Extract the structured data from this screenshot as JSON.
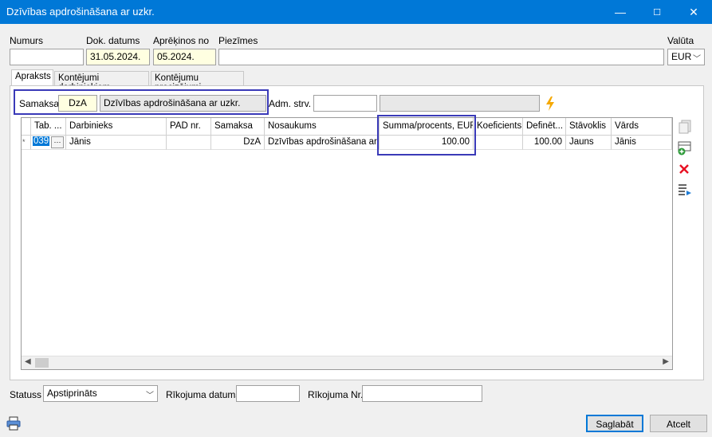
{
  "window": {
    "title": "Dzīvības apdrošināšana ar uzkr.",
    "minimize": "—",
    "maximize": "☐",
    "close": "✕"
  },
  "header": {
    "numurs_label": "Numurs",
    "numurs_value": "",
    "dok_datums_label": "Dok. datums",
    "dok_datums_value": "31.05.2024.",
    "aprekinos_label": "Aprēķinos no",
    "aprekinos_value": "05.2024.",
    "piezimes_label": "Piezīmes",
    "piezimes_value": "",
    "valuta_label": "Valūta",
    "valuta_value": "EUR"
  },
  "tabs": [
    {
      "label": "Apraksts"
    },
    {
      "label": "Kontējumi darbiniekiem"
    },
    {
      "label": "Kontējumu precizējumi"
    }
  ],
  "samaksa": {
    "label": "Samaksa",
    "code": "DzA",
    "name": "Dzīvības apdrošināšana ar uzkr."
  },
  "adm": {
    "label": "Adm. strv.",
    "value": "",
    "name": ""
  },
  "grid": {
    "columns": [
      "Tab. ...",
      "Darbinieks",
      "PAD nr.",
      "Samaksa",
      "Nosaukums",
      "Summa/procents, EUR",
      "Koeficients",
      "Definēt...",
      "Stāvoklis",
      "Vārds"
    ],
    "rows": [
      {
        "indicator": "*",
        "tab": "039",
        "more": "···",
        "darbinieks": "Jānis",
        "pad": "",
        "samaksa": "DzA",
        "nosaukums": "Dzīvības apdrošināšana ar ...",
        "summa": "100.00",
        "koef": "",
        "definet": "100.00",
        "stavoklis": "Jauns",
        "vards": "Jānis"
      }
    ]
  },
  "footer": {
    "statuss_label": "Statuss",
    "statuss_value": "Apstiprināts",
    "rikojuma_datums_label": "Rīkojuma datums",
    "rikojuma_datums_value": "",
    "rikojuma_nr_label": "Rīkojuma Nr.",
    "rikojuma_nr_value": "",
    "save_label": "Saglabāt",
    "cancel_label": "Atcelt"
  },
  "icons": {
    "lightning": "lightning-icon",
    "print": "printer-icon"
  },
  "colors": {
    "titlebar": "#0078d7",
    "highlight": "#3a3ab8",
    "yellow_field": "#ffffe1",
    "delete": "#e81123"
  }
}
